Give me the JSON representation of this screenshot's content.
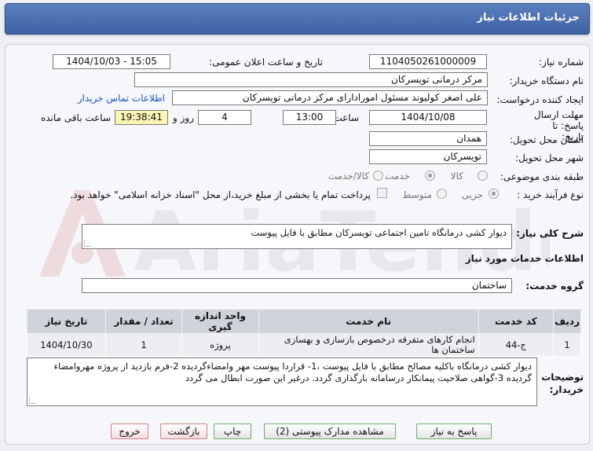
{
  "header": {
    "title": "جزئیات اطلاعات نیاز"
  },
  "watermark": {
    "text": "AriaTender.net"
  },
  "form": {
    "need_number": {
      "label": "شماره نیاز:",
      "value": "1104050261000009"
    },
    "announce": {
      "label": "تاریخ و ساعت اعلان عمومی:",
      "value": "1404/10/03 - 15:05"
    },
    "buyer_org": {
      "label": "نام دستگاه خریدار:",
      "value": "مرکز درمانی تویسرکان"
    },
    "requester": {
      "label": "ایجاد کننده درخواست:",
      "value": "علی اصغر کولیوند مسئول امورادارای مرکز درمانی تویسرکان",
      "contact_link": "اطلاعات تماس خریدار"
    },
    "deadline": {
      "label": "مهلت ارسال پاسخ: تا تاریخ:",
      "date": "1404/10/08",
      "time_label": "ساعت",
      "time": "13:00",
      "days": "4",
      "days_label": "روز و",
      "remaining": "19:38:41",
      "remaining_label": "ساعت باقی مانده"
    },
    "province": {
      "label": "استان محل تحویل:",
      "value": "همدان"
    },
    "city": {
      "label": "شهر محل تحویل:",
      "value": "تویسرکان"
    },
    "category": {
      "label": "طبقه بندی موضوعی:",
      "options": [
        "کالا",
        "خدمت",
        "کالا/خدمت"
      ],
      "selected": "خدمت"
    },
    "process": {
      "label": "نوع فرآیند خرید :",
      "options": [
        "جزیی",
        "متوسط"
      ],
      "selected": "جزیی",
      "payment_note": "پرداخت تمام یا بخشی از مبلغ خرید،از محل \"اسناد خزانه اسلامی\" خواهد بود."
    },
    "summary": {
      "label": "شرح کلی نیاز:",
      "value": "دیوار کشی درمانگاه تامین اجتماعی تویسرکان مطابق با فایل پیوست"
    },
    "services_title": "اطلاعات خدمات مورد نیاز",
    "service_group": {
      "label": "گروه خدمت:",
      "value": "ساختمان"
    }
  },
  "table": {
    "headers": [
      "ردیف",
      "کد خدمت",
      "نام خدمت",
      "واحد اندازه گیری",
      "تعداد / مقدار",
      "تاریخ نیاز"
    ],
    "rows": [
      [
        "1",
        "ج-44",
        "انجام کارهای متفرقه درخصوص بازسازی و بهسازی ساختمان ها",
        "پروژه",
        "1",
        "1404/10/30"
      ]
    ]
  },
  "description": {
    "label": "توضیحات خریدار:",
    "value": "دیوار کشی درمانگاه باکلیه مصالح مطابق با فایل پیوست ،1- قراردا پیوست مهر وامضاءگردیده  2-فرم بازدید از پروژه مهروامضاء گردیده 3-گواهی صلاحیت پیمانکار درسامانه بارگذاری گردد.  درغیر این صورت ابطال می گردد"
  },
  "buttons": {
    "reply": "پاسخ به نیاز",
    "attachments": "مشاهده مدارک پیوستی (2)",
    "print": "چاپ",
    "back": "بازگشت",
    "exit": "خروج"
  }
}
